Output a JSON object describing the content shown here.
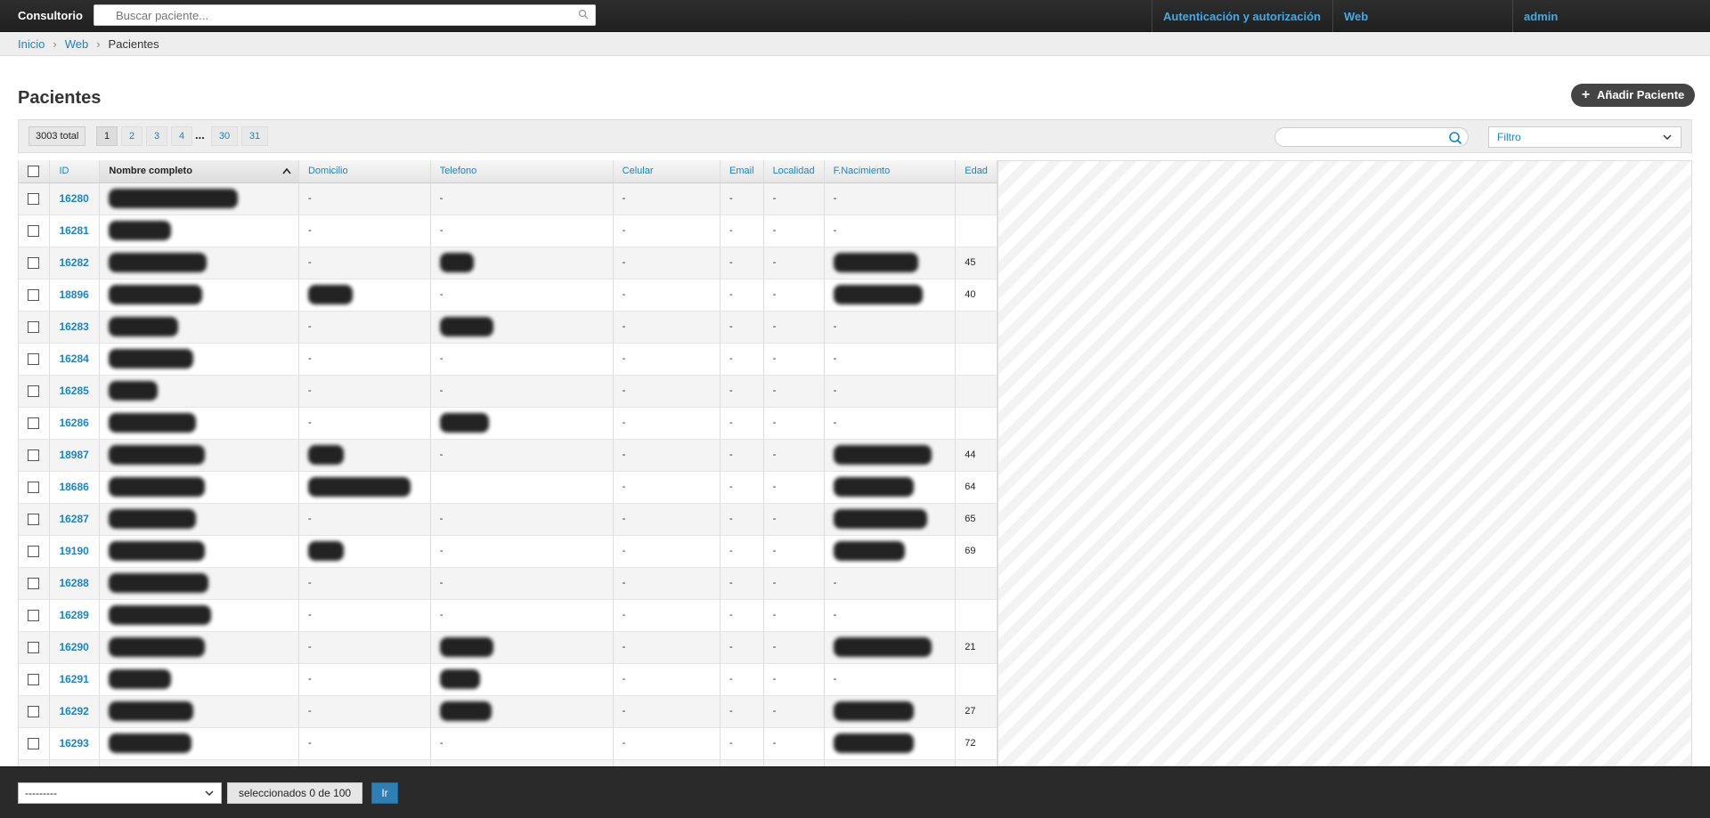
{
  "header": {
    "brand": "Consultorio",
    "search_placeholder": "Buscar paciente...",
    "nav": [
      "Autenticación y autorización",
      "Web",
      "admin"
    ]
  },
  "breadcrumb": [
    "Inicio",
    "Web",
    "Pacientes"
  ],
  "page": {
    "title": "Pacientes",
    "add_button": "Añadir Paciente"
  },
  "toolbar": {
    "total": "3003 total",
    "pages": [
      "1",
      "2",
      "3",
      "4",
      "30",
      "31"
    ],
    "ellipsis": "...",
    "current_page": "1",
    "filter_label": "Filtro"
  },
  "table": {
    "columns": [
      "ID",
      "Nombre completo",
      "Domicilio",
      "Telefono",
      "Celular",
      "Email",
      "Localidad",
      "F.Nacimiento",
      "Edad"
    ],
    "sorted_column": "Nombre completo",
    "rows": [
      {
        "id": "16280",
        "nombre": "",
        "domicilio": "-",
        "telefono": "-",
        "celular": "-",
        "email": "-",
        "localidad": "-",
        "nacimiento": "-",
        "edad": ""
      },
      {
        "id": "16281",
        "nombre": "",
        "domicilio": "-",
        "telefono": "-",
        "celular": "-",
        "email": "-",
        "localidad": "-",
        "nacimiento": "-",
        "edad": ""
      },
      {
        "id": "16282",
        "nombre": "",
        "domicilio": "-",
        "telefono": "",
        "celular": "-",
        "email": "-",
        "localidad": "-",
        "nacimiento": "",
        "edad": "45"
      },
      {
        "id": "18896",
        "nombre": "",
        "domicilio": "",
        "telefono": "-",
        "celular": "-",
        "email": "-",
        "localidad": "-",
        "nacimiento": "",
        "edad": "40"
      },
      {
        "id": "16283",
        "nombre": "",
        "domicilio": "-",
        "telefono": "",
        "celular": "-",
        "email": "-",
        "localidad": "-",
        "nacimiento": "-",
        "edad": ""
      },
      {
        "id": "16284",
        "nombre": "",
        "domicilio": "-",
        "telefono": "-",
        "celular": "-",
        "email": "-",
        "localidad": "-",
        "nacimiento": "-",
        "edad": ""
      },
      {
        "id": "16285",
        "nombre": "",
        "domicilio": "-",
        "telefono": "-",
        "celular": "-",
        "email": "-",
        "localidad": "-",
        "nacimiento": "-",
        "edad": ""
      },
      {
        "id": "16286",
        "nombre": "",
        "domicilio": "-",
        "telefono": "",
        "celular": "-",
        "email": "-",
        "localidad": "-",
        "nacimiento": "-",
        "edad": ""
      },
      {
        "id": "18987",
        "nombre": "",
        "domicilio": "",
        "telefono": "-",
        "celular": "-",
        "email": "-",
        "localidad": "-",
        "nacimiento": "",
        "edad": "44"
      },
      {
        "id": "18686",
        "nombre": "",
        "domicilio": "",
        "telefono": "",
        "celular": "-",
        "email": "-",
        "localidad": "-",
        "nacimiento": "",
        "edad": "64"
      },
      {
        "id": "16287",
        "nombre": "",
        "domicilio": "-",
        "telefono": "-",
        "celular": "-",
        "email": "-",
        "localidad": "-",
        "nacimiento": "",
        "edad": "65"
      },
      {
        "id": "19190",
        "nombre": "",
        "domicilio": "",
        "telefono": "-",
        "celular": "-",
        "email": "-",
        "localidad": "-",
        "nacimiento": "",
        "edad": "69"
      },
      {
        "id": "16288",
        "nombre": "",
        "domicilio": "-",
        "telefono": "-",
        "celular": "-",
        "email": "-",
        "localidad": "-",
        "nacimiento": "-",
        "edad": ""
      },
      {
        "id": "16289",
        "nombre": "",
        "domicilio": "-",
        "telefono": "-",
        "celular": "-",
        "email": "-",
        "localidad": "-",
        "nacimiento": "-",
        "edad": ""
      },
      {
        "id": "16290",
        "nombre": "",
        "domicilio": "-",
        "telefono": "",
        "celular": "-",
        "email": "-",
        "localidad": "-",
        "nacimiento": "",
        "edad": "21"
      },
      {
        "id": "16291",
        "nombre": "",
        "domicilio": "-",
        "telefono": "",
        "celular": "-",
        "email": "-",
        "localidad": "-",
        "nacimiento": "-",
        "edad": ""
      },
      {
        "id": "16292",
        "nombre": "",
        "domicilio": "-",
        "telefono": "",
        "celular": "-",
        "email": "-",
        "localidad": "-",
        "nacimiento": "",
        "edad": "27"
      },
      {
        "id": "16293",
        "nombre": "",
        "domicilio": "-",
        "telefono": "-",
        "celular": "-",
        "email": "-",
        "localidad": "-",
        "nacimiento": "",
        "edad": "72"
      },
      {
        "id": "",
        "nombre": "",
        "domicilio": "",
        "telefono": "",
        "celular": "",
        "email": "",
        "localidad": "",
        "nacimiento": "",
        "edad": ""
      }
    ]
  },
  "actionbar": {
    "action_value": "---------",
    "selected_text": "seleccionados 0 de 100",
    "go_label": "Ir"
  },
  "colors": {
    "link": "#1c84c6",
    "header_bg": "#2a2a2a",
    "nav_link": "#4aa8e0"
  },
  "icons": [
    "search-icon",
    "plus-icon",
    "chevron-down-icon",
    "sort-up-icon",
    "checkbox-icon"
  ]
}
